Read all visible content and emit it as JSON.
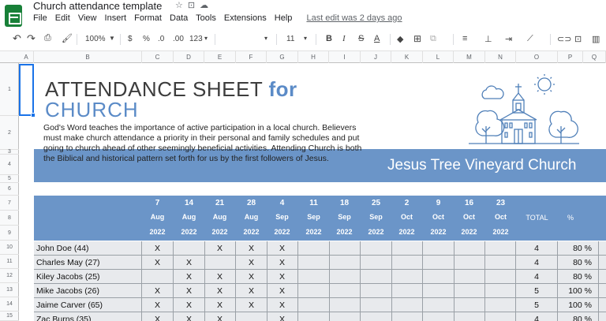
{
  "app": {
    "doc_title": "Church attendance template",
    "title_icons": [
      "star-icon",
      "move-to-folder-icon",
      "cloud-status-icon"
    ],
    "menu": [
      "File",
      "Edit",
      "View",
      "Insert",
      "Format",
      "Data",
      "Tools",
      "Extensions",
      "Help"
    ],
    "last_edit": "Last edit was 2 days ago"
  },
  "toolbar": {
    "zoom": "100%",
    "currency": "$",
    "percent": "%",
    "decrease_decimal": ".0",
    "increase_decimal": ".00",
    "more_formats": "123",
    "font_size": "11",
    "bold": "B",
    "italic": "I",
    "strikethrough": "S",
    "text_color": "A"
  },
  "grid": {
    "columns": [
      "A",
      "B",
      "C",
      "D",
      "E",
      "F",
      "G",
      "H",
      "I",
      "J",
      "K",
      "L",
      "M",
      "N",
      "O",
      "P",
      "Q"
    ],
    "rows": [
      "1",
      "2",
      "3",
      "4",
      "5",
      "6",
      "7",
      "8",
      "9",
      "10",
      "11",
      "12",
      "13",
      "14",
      "15"
    ]
  },
  "sheet": {
    "heading_main": "ATTENDANCE SHEET",
    "heading_for": "for",
    "heading_line2": "CHURCH",
    "description": "God's Word teaches the importance of active participation in a local church. Believers must make church attendance a priority in their personal and family schedules and put going to church ahead of other seemingly beneficial activities. Attending Church is both the Biblical and historical pattern set forth for us by the first followers of Jesus.",
    "church_name": "Jesus Tree Vineyard Church"
  },
  "table": {
    "dates": [
      {
        "day": "7",
        "month": "Aug",
        "year": "2022"
      },
      {
        "day": "14",
        "month": "Aug",
        "year": "2022"
      },
      {
        "day": "21",
        "month": "Aug",
        "year": "2022"
      },
      {
        "day": "28",
        "month": "Aug",
        "year": "2022"
      },
      {
        "day": "4",
        "month": "Sep",
        "year": "2022"
      },
      {
        "day": "11",
        "month": "Sep",
        "year": "2022"
      },
      {
        "day": "18",
        "month": "Sep",
        "year": "2022"
      },
      {
        "day": "25",
        "month": "Sep",
        "year": "2022"
      },
      {
        "day": "2",
        "month": "Oct",
        "year": "2022"
      },
      {
        "day": "9",
        "month": "Oct",
        "year": "2022"
      },
      {
        "day": "16",
        "month": "Oct",
        "year": "2022"
      },
      {
        "day": "23",
        "month": "Oct",
        "year": "2022"
      }
    ],
    "total_label": "TOTAL",
    "pct_label": "%",
    "mark": "X",
    "rows": [
      {
        "name": "John Doe (44)",
        "marks": [
          1,
          0,
          1,
          1,
          1,
          0,
          0,
          0,
          0,
          0,
          0,
          0
        ],
        "total": "4",
        "pct": "80 %"
      },
      {
        "name": "Charles May (27)",
        "marks": [
          1,
          1,
          0,
          1,
          1,
          0,
          0,
          0,
          0,
          0,
          0,
          0
        ],
        "total": "4",
        "pct": "80 %"
      },
      {
        "name": "Kiley Jacobs (25)",
        "marks": [
          0,
          1,
          1,
          1,
          1,
          0,
          0,
          0,
          0,
          0,
          0,
          0
        ],
        "total": "4",
        "pct": "80 %"
      },
      {
        "name": "Mike Jacobs (26)",
        "marks": [
          1,
          1,
          1,
          1,
          1,
          0,
          0,
          0,
          0,
          0,
          0,
          0
        ],
        "total": "5",
        "pct": "100 %"
      },
      {
        "name": "Jaime Carver (65)",
        "marks": [
          1,
          1,
          1,
          1,
          1,
          0,
          0,
          0,
          0,
          0,
          0,
          0
        ],
        "total": "5",
        "pct": "100 %"
      },
      {
        "name": "Zac Burns (35)",
        "marks": [
          1,
          1,
          1,
          0,
          1,
          0,
          0,
          0,
          0,
          0,
          0,
          0
        ],
        "total": "4",
        "pct": "80 %"
      }
    ]
  }
}
